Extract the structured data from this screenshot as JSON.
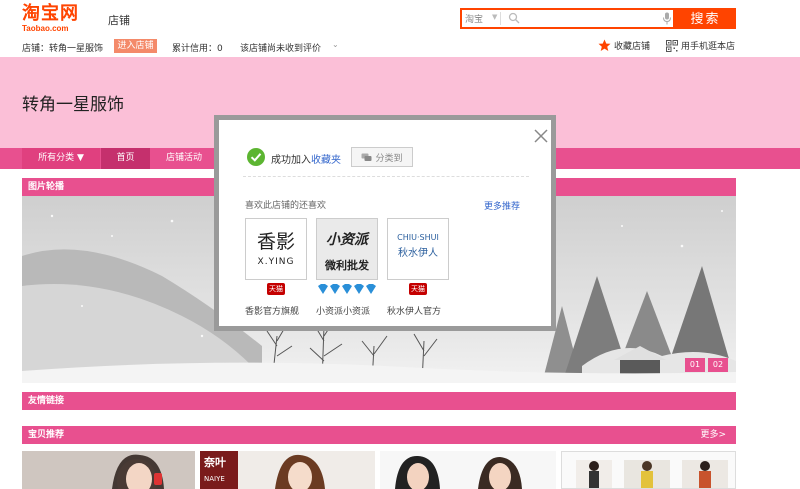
{
  "header": {
    "logo_main": "淘宝网",
    "logo_sub": "Taobao.com",
    "shop_label": "店铺",
    "search": {
      "scope": "淘宝",
      "placeholder": "",
      "button": "搜索"
    }
  },
  "infobar": {
    "shop_name": "店铺：转角一星服饰",
    "enter_shop": "进入店铺",
    "credit": "累计信用：0",
    "review": "该店铺尚未收到评价",
    "favorite_shop": "收藏店铺",
    "mobile_shop": "用手机逛本店"
  },
  "banner": {
    "title": "转角一星服饰"
  },
  "nav": {
    "all_categories": "所有分类 ▼",
    "home": "首页",
    "events": "店铺活动"
  },
  "sections": {
    "slideshow": "图片轮播",
    "friend_links": "友情链接",
    "recommended": "宝贝推荐",
    "more": "更多>"
  },
  "slideshow": {
    "dots": [
      "01",
      "02"
    ]
  },
  "modal": {
    "success_prefix": "成功加入",
    "success_link": "收藏夹",
    "classify": "分类到",
    "rec_label": "喜欢此店铺的还喜欢",
    "rec_more": "更多推荐",
    "shops": [
      {
        "logo_line1": "香影",
        "logo_line2": "X.YING",
        "badge": "天猫",
        "name": "香影官方旗舰"
      },
      {
        "logo_line1": "小资派",
        "logo_line2": "微利批发",
        "badge": "diamonds",
        "name": "小资派小资派"
      },
      {
        "logo_line1": "CHIU·SHUI",
        "logo_line2": "秋水伊人",
        "badge": "天猫",
        "name": "秋水伊人官方"
      }
    ]
  },
  "products": {
    "naiye_text": "奈叶",
    "naiye_sub": "NAIYE"
  },
  "colors": {
    "accent": "#ff4400",
    "pink": "#e8508f",
    "banner_pink": "#fbbfd7",
    "link_blue": "#3366cc",
    "diamond_blue": "#2a8fd8",
    "tmall_red": "#c40000"
  }
}
